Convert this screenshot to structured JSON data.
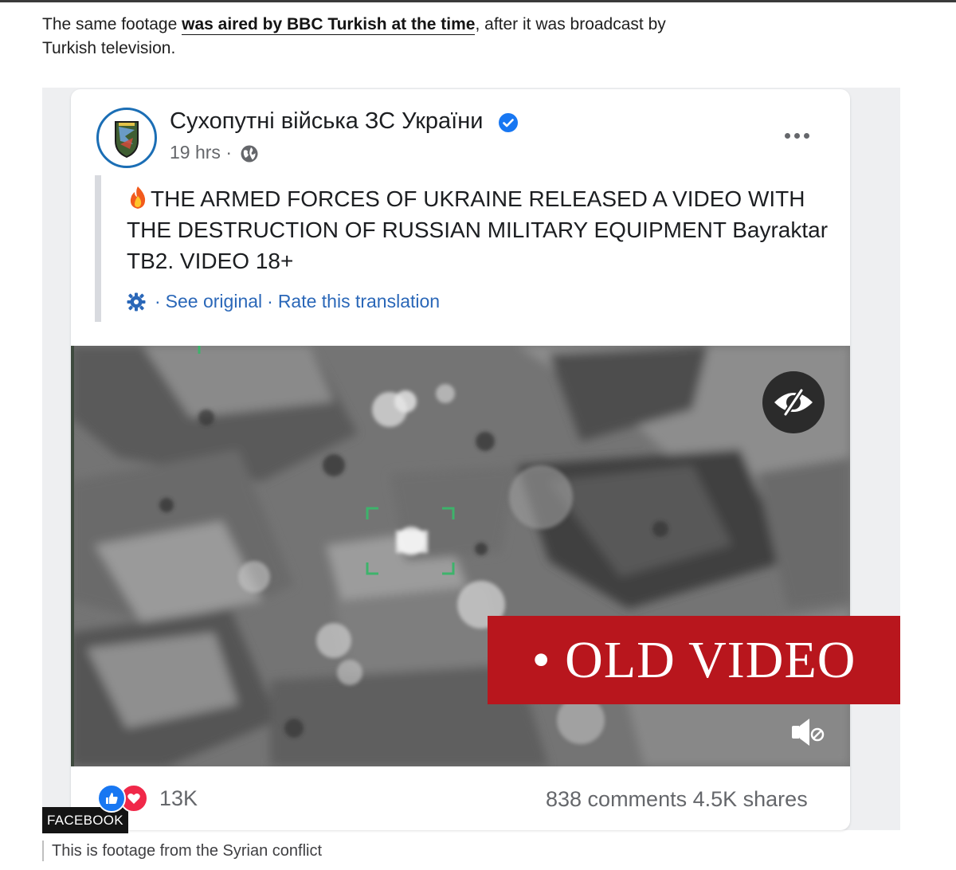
{
  "article": {
    "intro_before": "The same footage ",
    "intro_link": "was aired by BBC Turkish at the time",
    "intro_after": ", after it was broadcast by Turkish television."
  },
  "post": {
    "page_name": "Сухопутні війська ЗС України",
    "time": "19 hrs ·",
    "text": "THE ARMED FORCES OF UKRAINE RELEASED A VIDEO WITH THE DESTRUCTION OF RUSSIAN MILITARY EQUIPMENT Bayraktar TB2. VIDEO 18+",
    "see_original": "See original",
    "separator": "·",
    "rate_translation": "Rate this translation",
    "reaction_count": "13K",
    "comments": "838 comments",
    "shares": "4.5K shares"
  },
  "overlay": {
    "label": "• OLD VIDEO"
  },
  "figure": {
    "credit": "FACEBOOK",
    "caption": "This is footage from the Syrian conflict"
  },
  "colors": {
    "facebook_blue": "#1877f2",
    "link_blue": "#2a67b8",
    "old_video_red": "#b8161d",
    "love_red": "#f02849"
  },
  "icons": [
    "verified-badge-icon",
    "globe-icon",
    "more-options-icon",
    "fire-emoji-icon",
    "translate-gear-icon",
    "hide-content-icon",
    "mute-icon",
    "like-reaction-icon",
    "love-reaction-icon"
  ]
}
